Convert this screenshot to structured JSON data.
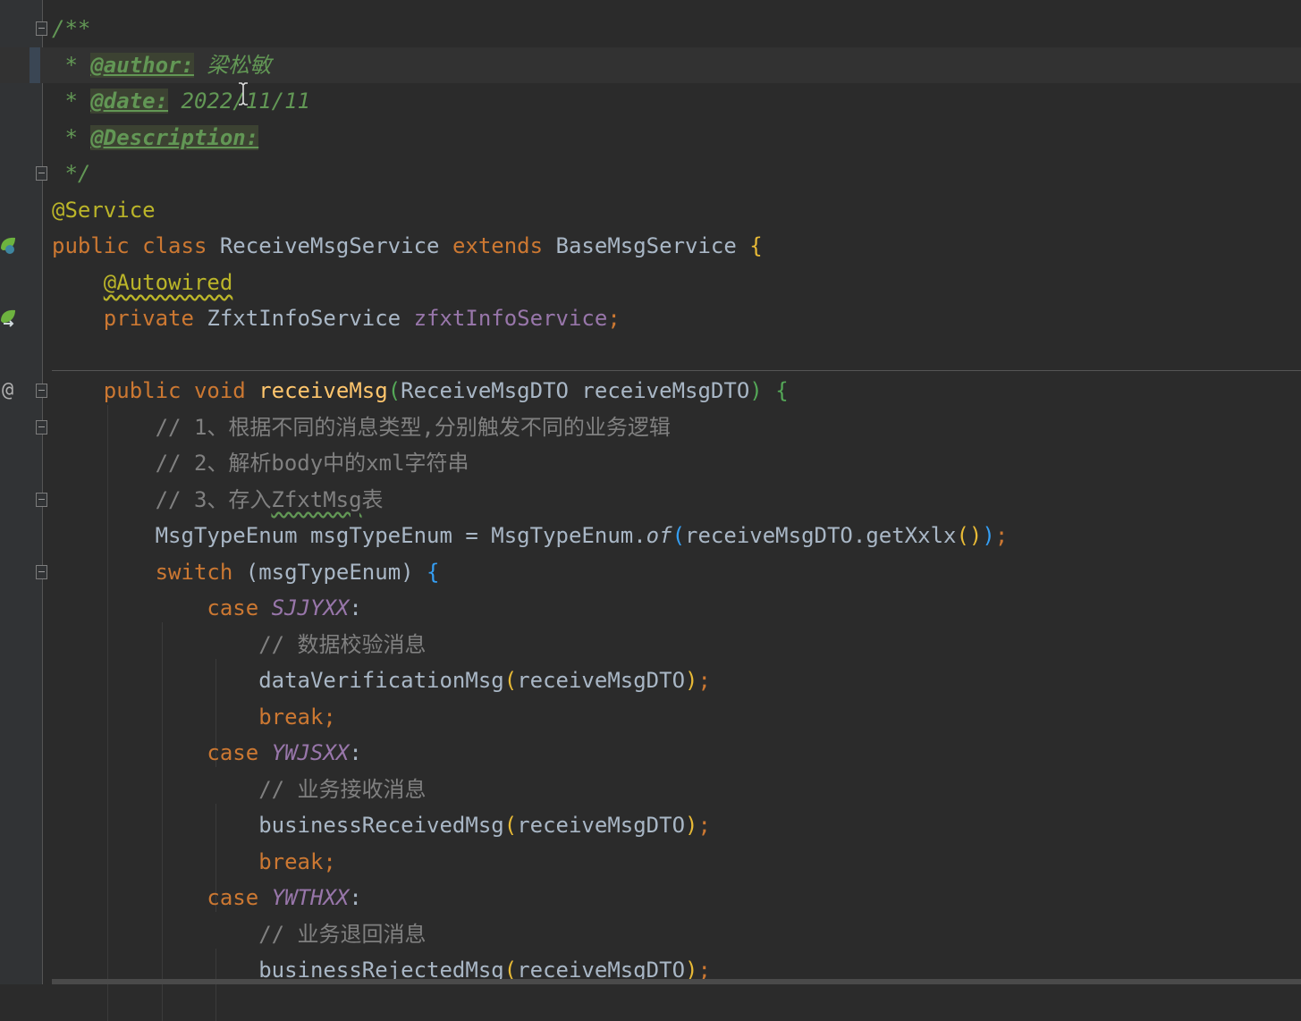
{
  "code_lines": [
    {
      "tokens": [
        {
          "t": "/**",
          "c": "doc"
        }
      ]
    },
    {
      "tokens": [
        {
          "t": " * ",
          "c": "doc"
        },
        {
          "t": "@author:",
          "c": "tag"
        },
        {
          "t": " 梁松敏",
          "c": "tagval"
        }
      ]
    },
    {
      "tokens": [
        {
          "t": " * ",
          "c": "doc"
        },
        {
          "t": "@date:",
          "c": "tag"
        },
        {
          "t": " 2022/11/11",
          "c": "tagval"
        }
      ]
    },
    {
      "tokens": [
        {
          "t": " * ",
          "c": "doc"
        },
        {
          "t": "@Description:",
          "c": "tag"
        }
      ]
    },
    {
      "tokens": [
        {
          "t": " */",
          "c": "doc"
        }
      ]
    },
    {
      "tokens": [
        {
          "t": "@Service",
          "c": "ann"
        }
      ]
    },
    {
      "tokens": [
        {
          "t": "public class ",
          "c": "kw"
        },
        {
          "t": "ReceiveMsgService "
        },
        {
          "t": "extends ",
          "c": "kw"
        },
        {
          "t": "BaseMsgService "
        },
        {
          "t": "{",
          "c": "p1"
        }
      ]
    },
    {
      "tokens": [
        {
          "t": "    "
        },
        {
          "t": "@Autowired",
          "c": "ann squig"
        }
      ]
    },
    {
      "tokens": [
        {
          "t": "    "
        },
        {
          "t": "private ",
          "c": "kw"
        },
        {
          "t": "ZfxtInfoService "
        },
        {
          "t": "zfxtInfoService",
          "c": "field"
        },
        {
          "t": ";",
          "c": "kw"
        }
      ]
    },
    {
      "tokens": []
    },
    {
      "tokens": [
        {
          "t": "    "
        },
        {
          "t": "public void ",
          "c": "kw"
        },
        {
          "t": "receiveMsg",
          "c": "fn"
        },
        {
          "t": "(",
          "c": "p2"
        },
        {
          "t": "ReceiveMsgDTO receiveMsgDTO"
        },
        {
          "t": ")",
          "c": "p2"
        },
        {
          "t": " "
        },
        {
          "t": "{",
          "c": "p2"
        }
      ]
    },
    {
      "tokens": [
        {
          "t": "        "
        },
        {
          "t": "// 1、根据不同的消息类型,分别触发不同的业务逻辑",
          "c": "cmt"
        }
      ]
    },
    {
      "tokens": [
        {
          "t": "        "
        },
        {
          "t": "// 2、解析body中的xml字符串",
          "c": "cmt"
        }
      ]
    },
    {
      "tokens": [
        {
          "t": "        "
        },
        {
          "t": "// 3、存入",
          "c": "cmt"
        },
        {
          "t": "ZfxtMsg",
          "c": "cmt squig-g"
        },
        {
          "t": "表",
          "c": "cmt"
        }
      ]
    },
    {
      "tokens": [
        {
          "t": "        MsgTypeEnum msgTypeEnum = MsgTypeEnum."
        },
        {
          "t": "of",
          "c": "st"
        },
        {
          "t": "(",
          "c": "p3"
        },
        {
          "t": "receiveMsgDTO.getXxlx"
        },
        {
          "t": "()",
          "c": "p1"
        },
        {
          "t": ")",
          "c": "p3"
        },
        {
          "t": ";",
          "c": "kw"
        }
      ]
    },
    {
      "tokens": [
        {
          "t": "        "
        },
        {
          "t": "switch ",
          "c": "kw"
        },
        {
          "t": "(msgTypeEnum) "
        },
        {
          "t": "{",
          "c": "p3"
        }
      ]
    },
    {
      "tokens": [
        {
          "t": "            "
        },
        {
          "t": "case ",
          "c": "kw"
        },
        {
          "t": "SJJYXX",
          "c": "enumc"
        },
        {
          "t": ":"
        }
      ]
    },
    {
      "tokens": [
        {
          "t": "                "
        },
        {
          "t": "// 数据校验消息",
          "c": "cmt"
        }
      ]
    },
    {
      "tokens": [
        {
          "t": "                dataVerificationMsg"
        },
        {
          "t": "(",
          "c": "p1"
        },
        {
          "t": "receiveMsgDTO"
        },
        {
          "t": ")",
          "c": "p1"
        },
        {
          "t": ";",
          "c": "kw"
        }
      ]
    },
    {
      "tokens": [
        {
          "t": "                "
        },
        {
          "t": "break;",
          "c": "kw"
        }
      ]
    },
    {
      "tokens": [
        {
          "t": "            "
        },
        {
          "t": "case ",
          "c": "kw"
        },
        {
          "t": "YWJSXX",
          "c": "enumc"
        },
        {
          "t": ":"
        }
      ]
    },
    {
      "tokens": [
        {
          "t": "                "
        },
        {
          "t": "// 业务接收消息",
          "c": "cmt"
        }
      ]
    },
    {
      "tokens": [
        {
          "t": "                businessReceivedMsg"
        },
        {
          "t": "(",
          "c": "p1"
        },
        {
          "t": "receiveMsgDTO"
        },
        {
          "t": ")",
          "c": "p1"
        },
        {
          "t": ";",
          "c": "kw"
        }
      ]
    },
    {
      "tokens": [
        {
          "t": "                "
        },
        {
          "t": "break;",
          "c": "kw"
        }
      ]
    },
    {
      "tokens": [
        {
          "t": "            "
        },
        {
          "t": "case ",
          "c": "kw"
        },
        {
          "t": "YWTHXX",
          "c": "enumc"
        },
        {
          "t": ":"
        }
      ]
    },
    {
      "tokens": [
        {
          "t": "                "
        },
        {
          "t": "// 业务退回消息",
          "c": "cmt"
        }
      ]
    },
    {
      "tokens": [
        {
          "t": "                businessRejectedMsg"
        },
        {
          "t": "(",
          "c": "p1"
        },
        {
          "t": "receiveMsgDTO"
        },
        {
          "t": ")",
          "c": "p1"
        },
        {
          "t": ";",
          "c": "kw"
        }
      ]
    }
  ],
  "gutter": {
    "fold_lines": [
      0,
      4,
      10,
      11,
      13,
      15
    ],
    "spring_bean_icon_line": 6,
    "injection_icon_line": 8,
    "override_marker_line": 10,
    "override_marker": "@"
  },
  "current_line": 1,
  "colors": {
    "background": "#2b2b2b",
    "gutter": "#313335",
    "keyword": "#cc7832",
    "annotation": "#bbb529",
    "field": "#9876aa",
    "method": "#ffc66d",
    "comment": "#808080",
    "doc_comment": "#629755",
    "default_text": "#a9b7c6"
  }
}
